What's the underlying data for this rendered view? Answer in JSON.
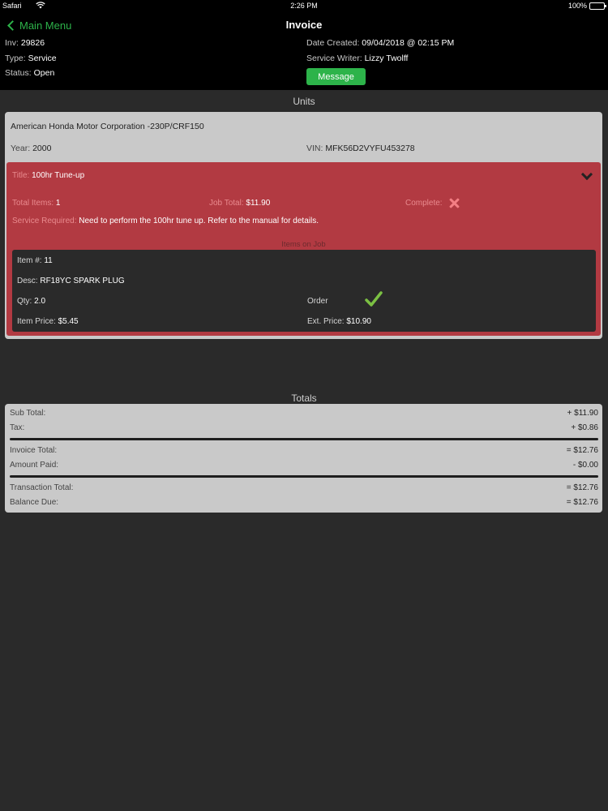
{
  "status_bar": {
    "carrier": "Safari",
    "time": "2:26 PM",
    "battery": "100%"
  },
  "nav": {
    "back_label": "Main Menu",
    "title": "Invoice"
  },
  "invoice": {
    "inv_label": "Inv:",
    "inv_value": "29826",
    "type_label": "Type:",
    "type_value": "Service",
    "status_label": "Status:",
    "status_value": "Open",
    "date_label": "Date Created:",
    "date_value": "09/04/2018 @ 02:15 PM",
    "writer_label": "Service Writer:",
    "writer_value": "Lizzy Twolff",
    "message_button": "Message"
  },
  "units": {
    "header": "Units",
    "unit_name": "American Honda Motor Corporation -230P/CRF150",
    "year_label": "Year:",
    "year_value": "2000",
    "vin_label": "VIN:",
    "vin_value": "MFK56D2VYFU453278",
    "job": {
      "title_label": "Title:",
      "title_value": "100hr Tune-up",
      "total_items_label": "Total Items:",
      "total_items_value": "1",
      "job_total_label": "Job Total:",
      "job_total_value": "$11.90",
      "complete_label": "Complete:",
      "service_required_label": "Service Required:",
      "service_required_value": "Need to perform the 100hr tune up. Refer to the manual for details.",
      "items_header": "Items on Job",
      "item": {
        "item_no_label": "Item #:",
        "item_no_value": "11",
        "desc_label": "Desc:",
        "desc_value": "RF18YC SPARK PLUG",
        "qty_label": "Qty:",
        "qty_value": "2.0",
        "order_label": "Order",
        "price_label": "Item Price:",
        "price_value": "$5.45",
        "ext_label": "Ext. Price:",
        "ext_value": "$10.90"
      }
    }
  },
  "totals": {
    "header": "Totals",
    "sub_total_label": "Sub Total:",
    "sub_total_value": "+ $11.90",
    "tax_label": "Tax:",
    "tax_value": "+ $0.86",
    "invoice_total_label": "Invoice Total:",
    "invoice_total_value": "= $12.76",
    "amount_paid_label": "Amount Paid:",
    "amount_paid_value": "- $0.00",
    "transaction_total_label": "Transaction Total:",
    "transaction_total_value": "= $12.76",
    "balance_due_label": "Balance Due:",
    "balance_due_value": "= $12.76"
  },
  "colors": {
    "accent_green": "#2db34a",
    "job_red": "#b23a42",
    "card_gray": "#c9c9c9",
    "background": "#2a2a2a"
  }
}
